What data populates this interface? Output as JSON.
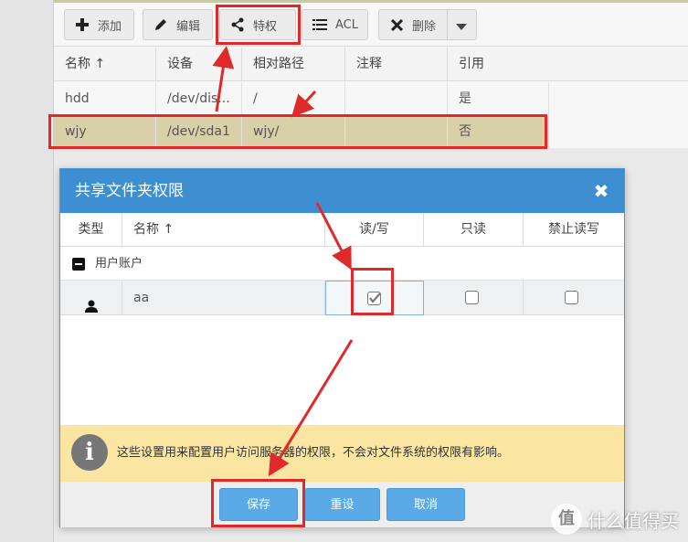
{
  "toolbar": {
    "add_label": "添加",
    "edit_label": "编辑",
    "privilege_label": "特权",
    "acl_label": "ACL",
    "delete_label": "删除"
  },
  "grid": {
    "columns": [
      "名称 ↑",
      "设备",
      "相对路径",
      "注释",
      "引用"
    ],
    "rows": [
      {
        "name": "hdd",
        "device": "/dev/dis...",
        "path": "/",
        "comment": "",
        "ref": "是"
      },
      {
        "name": "wjy",
        "device": "/dev/sda1",
        "path": "wjy/",
        "comment": "",
        "ref": "否"
      }
    ]
  },
  "dialog": {
    "title": "共享文件夹权限",
    "columns": {
      "type": "类型",
      "name": "名称 ↑",
      "rw": "读/写",
      "ro": "只读",
      "deny": "禁止读写"
    },
    "group_label": "用户账户",
    "user": {
      "name": "aa",
      "rw": true,
      "ro": false,
      "deny": false
    },
    "notice": "这些设置用来配置用户访问服务器的权限，不会对文件系统的权限有影响。",
    "buttons": {
      "save": "保存",
      "reset": "重设",
      "cancel": "取消"
    }
  },
  "watermark": {
    "logo": "值",
    "text": "什么值得买"
  },
  "colors": {
    "accent": "#3e8fd1",
    "highlight": "#e02a2a",
    "notice": "#fbe5a2",
    "button": "#5aaae8"
  }
}
